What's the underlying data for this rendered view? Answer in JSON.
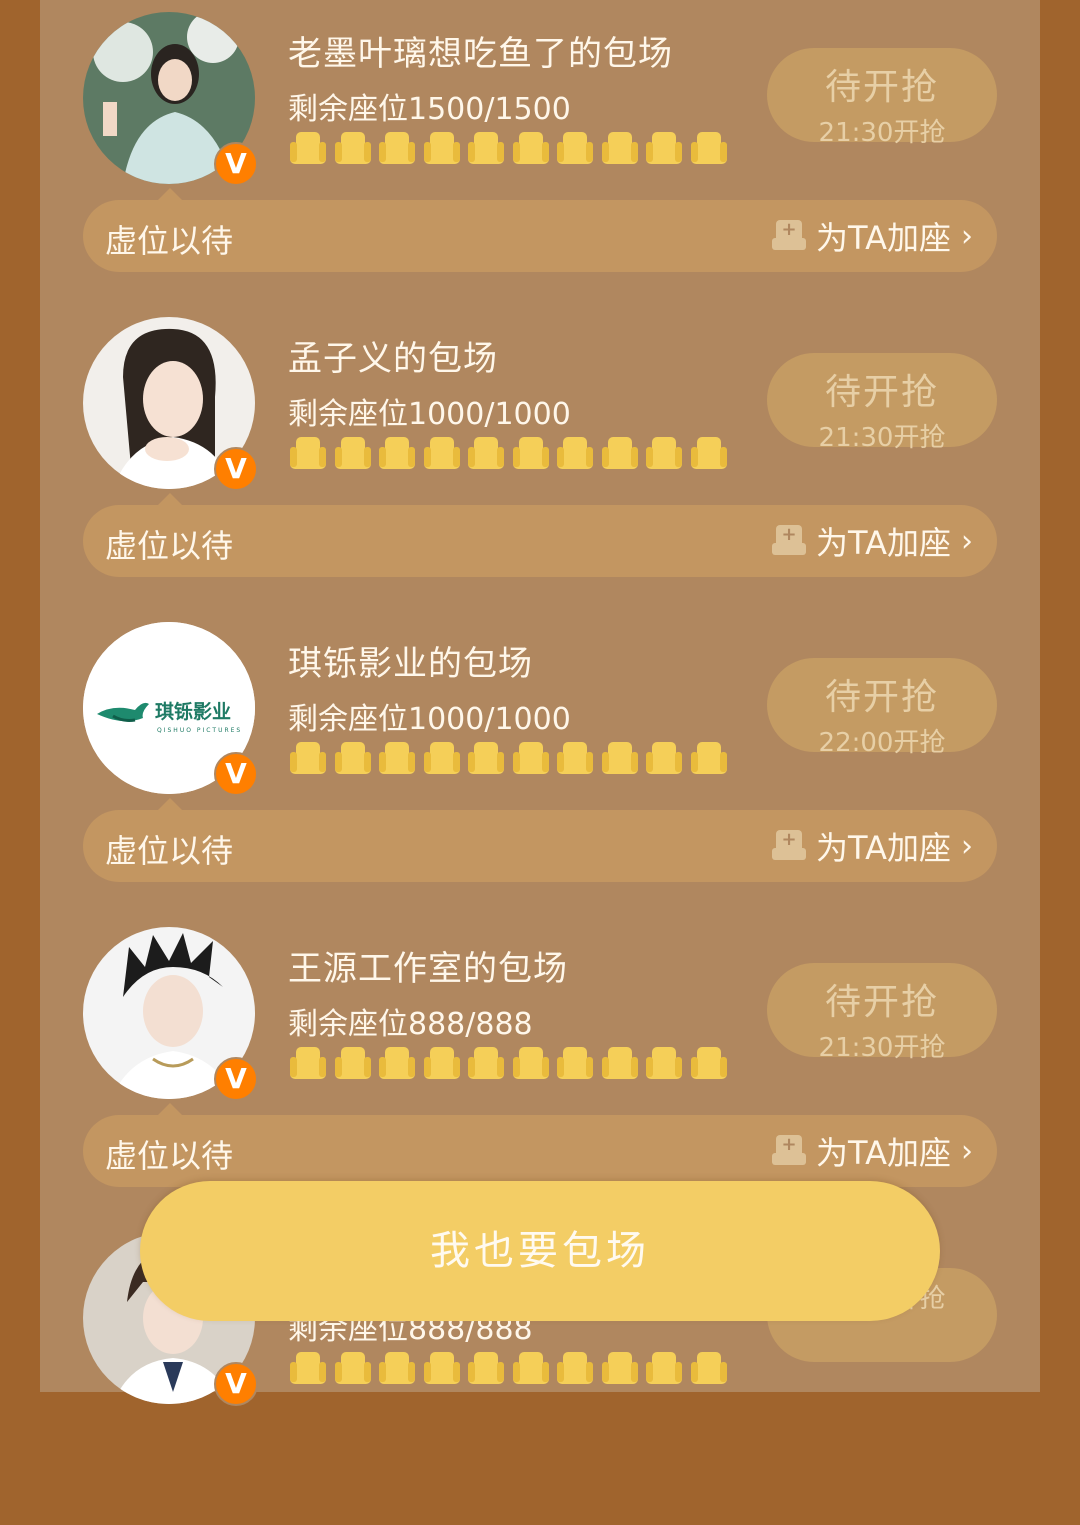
{
  "cards": [
    {
      "title": "老墨叶璃想吃鱼了的包场",
      "seats": "剩余座位1500/1500",
      "status": "待开抢",
      "time": "21:30开抢",
      "bar_text": "虚位以待",
      "add_label": "为TA加座",
      "avatar": "portrait-woman-icon"
    },
    {
      "title": "孟子义的包场",
      "seats": "剩余座位1000/1000",
      "status": "待开抢",
      "time": "21:30开抢",
      "bar_text": "虚位以待",
      "add_label": "为TA加座",
      "avatar": "portrait-woman-icon"
    },
    {
      "title": "琪铄影业的包场",
      "seats": "剩余座位1000/1000",
      "status": "待开抢",
      "time": "22:00开抢",
      "bar_text": "虚位以待",
      "add_label": "为TA加座",
      "avatar": "company-logo",
      "logo_text": "琪铄影业",
      "logo_sub": "QISHUO PICTURES"
    },
    {
      "title": "王源工作室的包场",
      "seats": "剩余座位888/888",
      "status": "待开抢",
      "time": "21:30开抢",
      "bar_text": "虚位以待",
      "add_label": "为TA加座",
      "avatar": "portrait-man-icon"
    },
    {
      "title": "",
      "seats": "剩余座位888/888",
      "status": "",
      "time": "21:30开抢",
      "bar_text": "",
      "add_label": "",
      "avatar": "portrait-man-icon"
    }
  ],
  "verified_badge": "V",
  "chevron": "›",
  "plus": "+",
  "cta_label": "我也要包场"
}
